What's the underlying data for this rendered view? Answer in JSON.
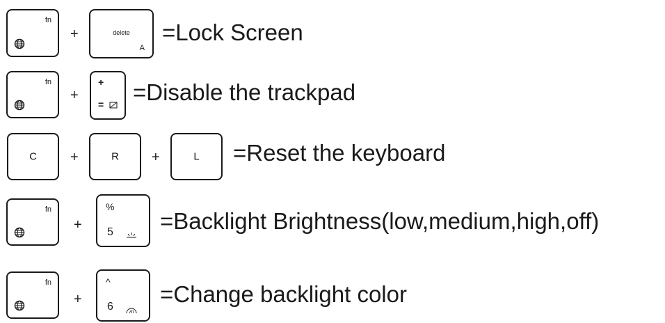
{
  "rows": [
    {
      "keys": [
        {
          "type": "fn",
          "label": "fn",
          "icon": "globe-icon"
        },
        {
          "type": "delete",
          "label": "delete",
          "sub": "A"
        }
      ],
      "plus": "+",
      "description": "=Lock Screen"
    },
    {
      "keys": [
        {
          "type": "fn",
          "label": "fn",
          "icon": "globe-icon"
        },
        {
          "type": "trackpad",
          "top": "+",
          "bottom": "=",
          "icon": "trackpad-off-icon"
        }
      ],
      "plus": "+",
      "description": "=Disable the trackpad"
    },
    {
      "keys": [
        {
          "type": "letter",
          "label": "C"
        },
        {
          "type": "letter",
          "label": "R"
        },
        {
          "type": "letter",
          "label": "L"
        }
      ],
      "plus": "+",
      "description": "=Reset the keyboard"
    },
    {
      "keys": [
        {
          "type": "fn",
          "label": "fn",
          "icon": "globe-icon"
        },
        {
          "type": "num",
          "top": "%",
          "num": "5",
          "icon": "backlight-brightness-icon"
        }
      ],
      "plus": "+",
      "description": "=Backlight Brightness(low,medium,high,off)"
    },
    {
      "keys": [
        {
          "type": "fn",
          "label": "fn",
          "icon": "globe-icon"
        },
        {
          "type": "num",
          "top": "^",
          "num": "6",
          "icon": "backlight-color-icon"
        }
      ],
      "plus": "+",
      "description": "=Change backlight color"
    }
  ]
}
